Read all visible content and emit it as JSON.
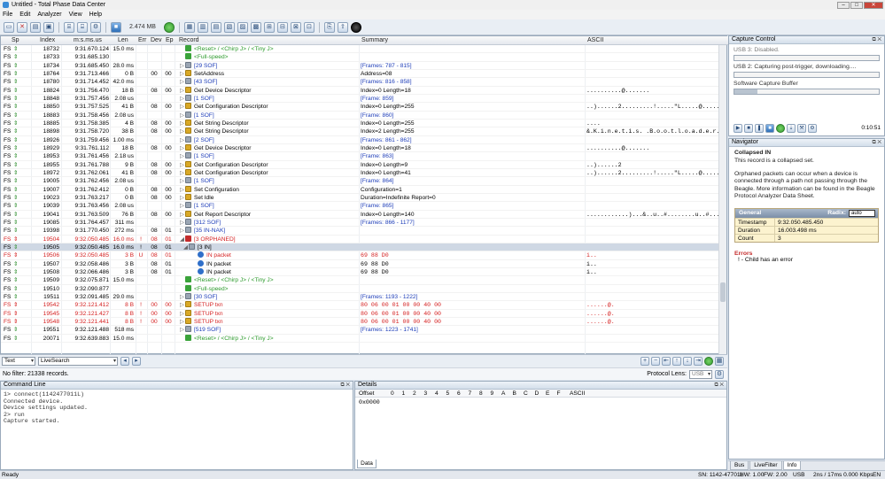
{
  "app": {
    "title": "Untitled - Total Phase Data Center"
  },
  "menu": [
    "File",
    "Edit",
    "Analyzer",
    "View",
    "Help"
  ],
  "toolbar": {
    "size_label": "2.474 MB"
  },
  "columns": [
    "Sp",
    "Index",
    "m:s.ms.us",
    "Len",
    "Err",
    "Dev",
    "Ep",
    "Record",
    "Summary",
    "ASCII"
  ],
  "rows": [
    {
      "fs": "FS",
      "index": "18732",
      "time": "9:31.670.124",
      "len": "15.0 ms",
      "err": "",
      "dev": "",
      "ep": "",
      "record": "<Reset> / <Chirp J> / <Tiny J>",
      "summary": "",
      "ascii": "",
      "kind": "green",
      "icon": "flag",
      "arrow": ""
    },
    {
      "fs": "FS",
      "index": "18733",
      "time": "9:31.685.130",
      "len": "",
      "err": "",
      "dev": "",
      "ep": "",
      "record": "<Full-speed>",
      "summary": "",
      "ascii": "",
      "kind": "green",
      "icon": "flag",
      "arrow": ""
    },
    {
      "fs": "FS",
      "index": "18734",
      "time": "9:31.685.450",
      "len": "28.0 ms",
      "err": "",
      "dev": "",
      "ep": "",
      "record": "[29 SOF]",
      "summary": "[Frames: 787 - 815]",
      "ascii": "",
      "kind": "blue",
      "icon": "sof",
      "arrow": "▷"
    },
    {
      "fs": "FS",
      "index": "18764",
      "time": "9:31.713.466",
      "len": "0 B",
      "err": "",
      "dev": "00",
      "ep": "00",
      "record": "SetAddress",
      "summary": "Address=08",
      "ascii": "",
      "kind": "",
      "icon": "pkt",
      "arrow": "▷"
    },
    {
      "fs": "FS",
      "index": "18780",
      "time": "9:31.714.452",
      "len": "42.0 ms",
      "err": "",
      "dev": "",
      "ep": "",
      "record": "[43 SOF]",
      "summary": "[Frames: 816 - 858]",
      "ascii": "",
      "kind": "blue",
      "icon": "sof",
      "arrow": "▷"
    },
    {
      "fs": "FS",
      "index": "18824",
      "time": "9:31.756.470",
      "len": "18 B",
      "err": "",
      "dev": "08",
      "ep": "00",
      "record": "Get Device Descriptor",
      "summary": "Index=0 Length=18",
      "ascii": "..........@.......",
      "kind": "",
      "icon": "pkt",
      "arrow": "▷"
    },
    {
      "fs": "FS",
      "index": "18848",
      "time": "9:31.757.456",
      "len": "2.08 us",
      "err": "",
      "dev": "",
      "ep": "",
      "record": "[1 SOF]",
      "summary": "[Frame: 859]",
      "ascii": "",
      "kind": "blue",
      "icon": "sof",
      "arrow": "▷"
    },
    {
      "fs": "FS",
      "index": "18850",
      "time": "9:31.757.525",
      "len": "41 B",
      "err": "",
      "dev": "08",
      "ep": "00",
      "record": "Get Configuration Descriptor",
      "summary": "Index=0 Length=255",
      "ascii": "..)......2.........!.....\"L.....@.....@..",
      "kind": "",
      "icon": "pkt",
      "arrow": "▷"
    },
    {
      "fs": "FS",
      "index": "18883",
      "time": "9:31.758.456",
      "len": "2.08 us",
      "err": "",
      "dev": "",
      "ep": "",
      "record": "[1 SOF]",
      "summary": "[Frame: 860]",
      "ascii": "",
      "kind": "blue",
      "icon": "sof",
      "arrow": "▷"
    },
    {
      "fs": "FS",
      "index": "18885",
      "time": "9:31.758.385",
      "len": "4 B",
      "err": "",
      "dev": "08",
      "ep": "00",
      "record": "Get String Descriptor",
      "summary": "Index=0 Length=255",
      "ascii": "....",
      "kind": "",
      "icon": "pkt",
      "arrow": "▷"
    },
    {
      "fs": "FS",
      "index": "18898",
      "time": "9:31.758.720",
      "len": "38 B",
      "err": "",
      "dev": "08",
      "ep": "00",
      "record": "Get String Descriptor",
      "summary": "Index=2 Length=255",
      "ascii": "&.K.i.n.e.t.i.s. .B.o.o.t.l.o.a.d.e.r.",
      "kind": "",
      "icon": "pkt",
      "arrow": "▷"
    },
    {
      "fs": "FS",
      "index": "18926",
      "time": "9:31.759.456",
      "len": "1.00 ms",
      "err": "",
      "dev": "",
      "ep": "",
      "record": "[2 SOF]",
      "summary": "[Frames: 861 - 862]",
      "ascii": "",
      "kind": "blue",
      "icon": "sof",
      "arrow": "▷"
    },
    {
      "fs": "FS",
      "index": "18929",
      "time": "9:31.761.112",
      "len": "18 B",
      "err": "",
      "dev": "08",
      "ep": "00",
      "record": "Get Device Descriptor",
      "summary": "Index=0 Length=18",
      "ascii": "..........@.......",
      "kind": "",
      "icon": "pkt",
      "arrow": "▷"
    },
    {
      "fs": "FS",
      "index": "18953",
      "time": "9:31.761.456",
      "len": "2.18 us",
      "err": "",
      "dev": "",
      "ep": "",
      "record": "[1 SOF]",
      "summary": "[Frame: 863]",
      "ascii": "",
      "kind": "blue",
      "icon": "sof",
      "arrow": "▷"
    },
    {
      "fs": "FS",
      "index": "18955",
      "time": "9:31.761.788",
      "len": "9 B",
      "err": "",
      "dev": "08",
      "ep": "00",
      "record": "Get Configuration Descriptor",
      "summary": "Index=0 Length=9",
      "ascii": "..)......2",
      "kind": "",
      "icon": "pkt",
      "arrow": "▷"
    },
    {
      "fs": "FS",
      "index": "18972",
      "time": "9:31.762.061",
      "len": "41 B",
      "err": "",
      "dev": "08",
      "ep": "00",
      "record": "Get Configuration Descriptor",
      "summary": "Index=0 Length=41",
      "ascii": "..)......2.........!.....\"L.....@.....@..",
      "kind": "",
      "icon": "pkt",
      "arrow": "▷"
    },
    {
      "fs": "FS",
      "index": "19005",
      "time": "9:31.762.456",
      "len": "2.08 us",
      "err": "",
      "dev": "",
      "ep": "",
      "record": "[1 SOF]",
      "summary": "[Frame: 864]",
      "ascii": "",
      "kind": "blue",
      "icon": "sof",
      "arrow": "▷"
    },
    {
      "fs": "FS",
      "index": "19007",
      "time": "9:31.762.412",
      "len": "0 B",
      "err": "",
      "dev": "08",
      "ep": "00",
      "record": "Set Configuration",
      "summary": "Configuration=1",
      "ascii": "",
      "kind": "",
      "icon": "pkt",
      "arrow": "▷"
    },
    {
      "fs": "FS",
      "index": "19023",
      "time": "9:31.763.217",
      "len": "0 B",
      "err": "",
      "dev": "08",
      "ep": "00",
      "record": "Set Idle",
      "summary": "Duration=Indefinite Report=0",
      "ascii": "",
      "kind": "",
      "icon": "pkt",
      "arrow": "▷"
    },
    {
      "fs": "FS",
      "index": "19039",
      "time": "9:31.763.456",
      "len": "2.08 us",
      "err": "",
      "dev": "",
      "ep": "",
      "record": "[1 SOF]",
      "summary": "[Frame: 865]",
      "ascii": "",
      "kind": "blue",
      "icon": "sof",
      "arrow": "▷"
    },
    {
      "fs": "FS",
      "index": "19041",
      "time": "9:31.763.509",
      "len": "76 B",
      "err": "",
      "dev": "08",
      "ep": "00",
      "record": "Get Report Descriptor",
      "summary": "Index=0 Length=140",
      "ascii": "............)...&..u..#........u..#......@...u..",
      "kind": "",
      "icon": "pkt",
      "arrow": "▷"
    },
    {
      "fs": "FS",
      "index": "19085",
      "time": "9:31.764.457",
      "len": "311 ms",
      "err": "",
      "dev": "",
      "ep": "",
      "record": "[312 SOF]",
      "summary": "[Frames: 866 - 1177]",
      "ascii": "",
      "kind": "blue",
      "icon": "sof",
      "arrow": "▷"
    },
    {
      "fs": "FS",
      "index": "19398",
      "time": "9:31.770.450",
      "len": "272 ms",
      "err": "",
      "dev": "08",
      "ep": "01",
      "record": "[35 IN-NAK]",
      "summary": "",
      "ascii": "",
      "kind": "blue",
      "icon": "sof",
      "arrow": "▷"
    },
    {
      "fs": "FS",
      "index": "19504",
      "time": "9:32.050.485",
      "len": "16.0 ms",
      "err": "!",
      "dev": "08",
      "ep": "01",
      "record": "[3 ORPHANED]",
      "summary": "",
      "ascii": "",
      "kind": "err",
      "icon": "err",
      "arrow": "◢"
    },
    {
      "fs": "FS",
      "index": "19505",
      "time": "9:32.050.485",
      "len": "16.0 ms",
      "err": "!",
      "dev": "08",
      "ep": "01",
      "record": "[3 IN]",
      "summary": "",
      "ascii": "",
      "kind": "sel",
      "icon": "sof",
      "arrow": "◢"
    },
    {
      "fs": "FS",
      "index": "19506",
      "time": "9:32.050.485",
      "len": "3 B",
      "err": "U",
      "dev": "08",
      "ep": "01",
      "record": "IN packet",
      "summary": "69 88 D0",
      "ascii": "i..",
      "kind": "err",
      "icon": "in",
      "arrow": ""
    },
    {
      "fs": "FS",
      "index": "19507",
      "time": "9:32.058.486",
      "len": "3 B",
      "err": "",
      "dev": "08",
      "ep": "01",
      "record": "IN packet",
      "summary": "69 88 D0",
      "ascii": "i..",
      "kind": "",
      "icon": "in",
      "arrow": ""
    },
    {
      "fs": "FS",
      "index": "19508",
      "time": "9:32.066.486",
      "len": "3 B",
      "err": "",
      "dev": "08",
      "ep": "01",
      "record": "IN packet",
      "summary": "69 88 D0",
      "ascii": "i..",
      "kind": "",
      "icon": "in",
      "arrow": ""
    },
    {
      "fs": "FS",
      "index": "19509",
      "time": "9:32.075.871",
      "len": "15.0 ms",
      "err": "",
      "dev": "",
      "ep": "",
      "record": "<Reset> / <Chirp J> / <Tiny J>",
      "summary": "",
      "ascii": "",
      "kind": "green",
      "icon": "flag",
      "arrow": ""
    },
    {
      "fs": "FS",
      "index": "19510",
      "time": "9:32.090.877",
      "len": "",
      "err": "",
      "dev": "",
      "ep": "",
      "record": "<Full-speed>",
      "summary": "",
      "ascii": "",
      "kind": "green",
      "icon": "flag",
      "arrow": ""
    },
    {
      "fs": "FS",
      "index": "19511",
      "time": "9:32.091.485",
      "len": "29.0 ms",
      "err": "",
      "dev": "",
      "ep": "",
      "record": "[30 SOF]",
      "summary": "[Frames: 1193 - 1222]",
      "ascii": "",
      "kind": "blue",
      "icon": "sof",
      "arrow": "▷"
    },
    {
      "fs": "FS",
      "index": "19542",
      "time": "9:32.121.412",
      "len": "8 B",
      "err": "!",
      "dev": "00",
      "ep": "00",
      "record": "SETUP txn",
      "summary": "80 06 00 01 00 00 40 00",
      "ascii": "......@.",
      "kind": "err",
      "icon": "pkt",
      "arrow": "▷"
    },
    {
      "fs": "FS",
      "index": "19545",
      "time": "9:32.121.427",
      "len": "8 B",
      "err": "!",
      "dev": "00",
      "ep": "00",
      "record": "SETUP txn",
      "summary": "80 06 00 01 00 00 40 00",
      "ascii": "......@.",
      "kind": "err",
      "icon": "pkt",
      "arrow": "▷"
    },
    {
      "fs": "FS",
      "index": "19548",
      "time": "9:32.121.441",
      "len": "8 B",
      "err": "!",
      "dev": "00",
      "ep": "00",
      "record": "SETUP txn",
      "summary": "80 06 00 01 00 00 40 00",
      "ascii": "......@.",
      "kind": "err",
      "icon": "pkt",
      "arrow": "▷"
    },
    {
      "fs": "FS",
      "index": "19551",
      "time": "9:32.121.488",
      "len": "518 ms",
      "err": "",
      "dev": "",
      "ep": "",
      "record": "[519 SOF]",
      "summary": "[Frames: 1223 - 1741]",
      "ascii": "",
      "kind": "blue",
      "icon": "sof",
      "arrow": "▷"
    },
    {
      "fs": "FS",
      "index": "20071",
      "time": "9:32.639.883",
      "len": "15.0 ms",
      "err": "",
      "dev": "",
      "ep": "",
      "record": "<Reset> / <Chirp J> / <Tiny J>",
      "summary": "",
      "ascii": "",
      "kind": "green",
      "icon": "flag",
      "arrow": ""
    }
  ],
  "filter": {
    "mode": "Text",
    "search": "LiveSearch",
    "status": "No filter: 21338 records.",
    "protocol_label": "Protocol Lens:",
    "protocol_value": "USB"
  },
  "command": {
    "title": "Command Line",
    "lines": [
      "1> connect(1142477011L)",
      "Connected device.",
      "Device settings updated.",
      "2> run",
      "Capture started."
    ]
  },
  "details": {
    "title": "Details",
    "offset_label": "Offset",
    "cols": [
      "0",
      "1",
      "2",
      "3",
      "4",
      "5",
      "6",
      "7",
      "8",
      "9",
      "A",
      "B",
      "C",
      "D",
      "E",
      "F"
    ],
    "ascii_label": "ASCII",
    "first_offset": "0x0000",
    "tab": "Data"
  },
  "capture": {
    "title": "Capture Control",
    "usb3": "USB 3: Disabled.",
    "usb2": "USB 2: Capturing post-trigger, downloading....",
    "buffer": "Software Capture Buffer",
    "time": "0:10:51",
    "usb2_progress": 0,
    "buffer_progress": 0.16
  },
  "navigator": {
    "title": "Navigator",
    "heading": "Collapsed IN",
    "line1": "This record is a collapsed set.",
    "para": "Orphaned packets can occur when a device is connected through a path not passing through the Beagle. More information can be found in the Beagle Protocol Analyzer Data Sheet.",
    "general": "General",
    "radix_label": "Radix:",
    "radix_value": "auto",
    "props": [
      {
        "k": "Timestamp",
        "v": "9:32.050.485.450"
      },
      {
        "k": "Duration",
        "v": "16.003.498 ms"
      },
      {
        "k": "Count",
        "v": "3"
      }
    ],
    "errors_title": "Errors",
    "errors": [
      "! - Child has an error"
    ],
    "tabs": [
      "Bus",
      "LiveFilter",
      "Info"
    ]
  },
  "status": {
    "left": "Ready",
    "sn": "SN: 1142-477011",
    "hw": "HW: 1.00",
    "fw": "FW: 2.00",
    "bus": "USB",
    "rate": "2ns / 17ms  0.000 Kbps",
    "lang": "EN"
  }
}
